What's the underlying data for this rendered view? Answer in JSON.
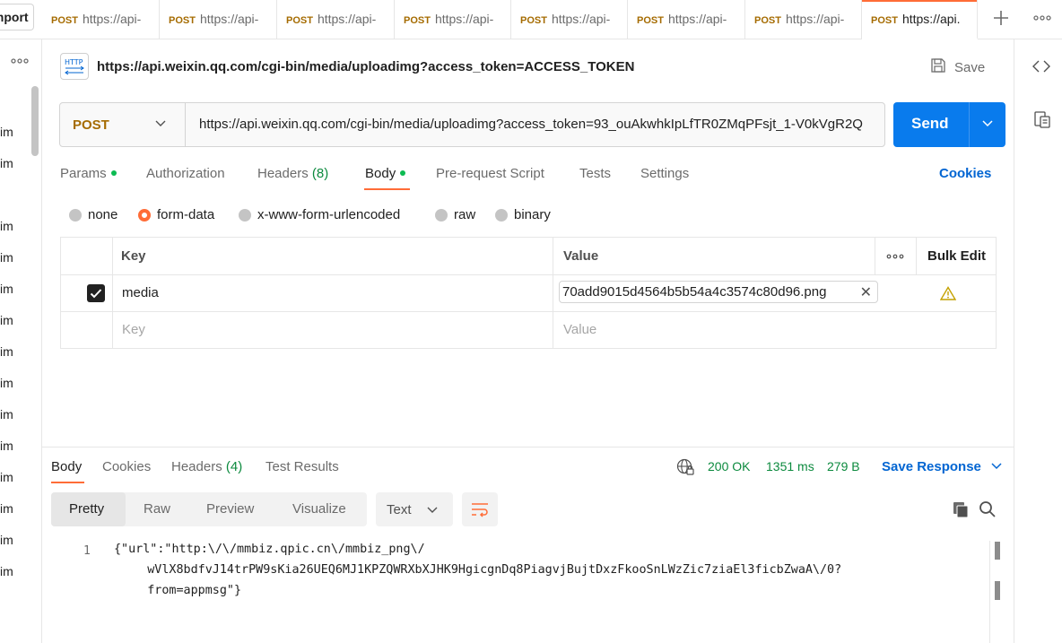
{
  "tabs": {
    "import_label": "Import",
    "items": [
      {
        "method": "POST",
        "label": "https://api-"
      },
      {
        "method": "POST",
        "label": "https://api-"
      },
      {
        "method": "POST",
        "label": "https://api-"
      },
      {
        "method": "POST",
        "label": "https://api-"
      },
      {
        "method": "POST",
        "label": "https://api-"
      },
      {
        "method": "POST",
        "label": "https://api-"
      },
      {
        "method": "POST",
        "label": "https://api-"
      },
      {
        "method": "POST",
        "label": "https://api."
      }
    ],
    "add_icon": "plus-icon",
    "more_icon": "more-horizontal-icon"
  },
  "sidebar": {
    "more_icon": "more-horizontal-icon",
    "items": [
      "im",
      "im",
      "im",
      "im",
      "im",
      "im",
      "im",
      "im",
      "im",
      "im",
      "im",
      "im",
      "im",
      "im"
    ]
  },
  "request": {
    "title": "https://api.weixin.qq.com/cgi-bin/media/uploadimg?access_token=ACCESS_TOKEN",
    "save_label": "Save",
    "method": "POST",
    "url": "https://api.weixin.qq.com/cgi-bin/media/uploadimg?access_token=93_ouAkwhkIpLfTR0ZMqPFsjt_1-V0kVgR2Q",
    "send_label": "Send"
  },
  "request_tabs": {
    "params": "Params",
    "authorization": "Authorization",
    "headers": "Headers",
    "headers_count": "(8)",
    "body": "Body",
    "prerequest": "Pre-request Script",
    "tests": "Tests",
    "settings": "Settings",
    "cookies": "Cookies"
  },
  "body_types": {
    "none": "none",
    "form_data": "form-data",
    "urlencoded": "x-www-form-urlencoded",
    "raw": "raw",
    "binary": "binary",
    "selected": "form-data"
  },
  "form_table": {
    "key_header": "Key",
    "value_header": "Value",
    "bulk_edit": "Bulk Edit",
    "row": {
      "key": "media",
      "value": "70add9015d4564b5b54a4c3574c80d96.png",
      "checked": true
    },
    "key_placeholder": "Key",
    "value_placeholder": "Value"
  },
  "response": {
    "tabs": {
      "body": "Body",
      "cookies": "Cookies",
      "headers": "Headers",
      "headers_count": "(4)",
      "test_results": "Test Results"
    },
    "status": "200 OK",
    "time": "1351 ms",
    "size": "279 B",
    "save_response": "Save Response",
    "formats": {
      "pretty": "Pretty",
      "raw": "Raw",
      "preview": "Preview",
      "visualize": "Visualize"
    },
    "type": "Text",
    "line_number": "1",
    "code_lines": [
      "{\"url\":\"http:\\/\\/mmbiz.qpic.cn\\/mmbiz_png\\/",
      "    wVlX8bdfvJ14trPW9sKia26UEQ6MJ1KPZQWRXbXJHK9HgicgnDq8PiagvjBujtDxzFkooSnLWzZic7ziaEl3ficbZwaA\\/0?",
      "    from=appmsg\"}"
    ]
  },
  "colors": {
    "accent": "#ff6c37",
    "send": "#097bed",
    "method": "#a56b00",
    "status_ok": "#0c8a3e",
    "link": "#0265d2"
  }
}
